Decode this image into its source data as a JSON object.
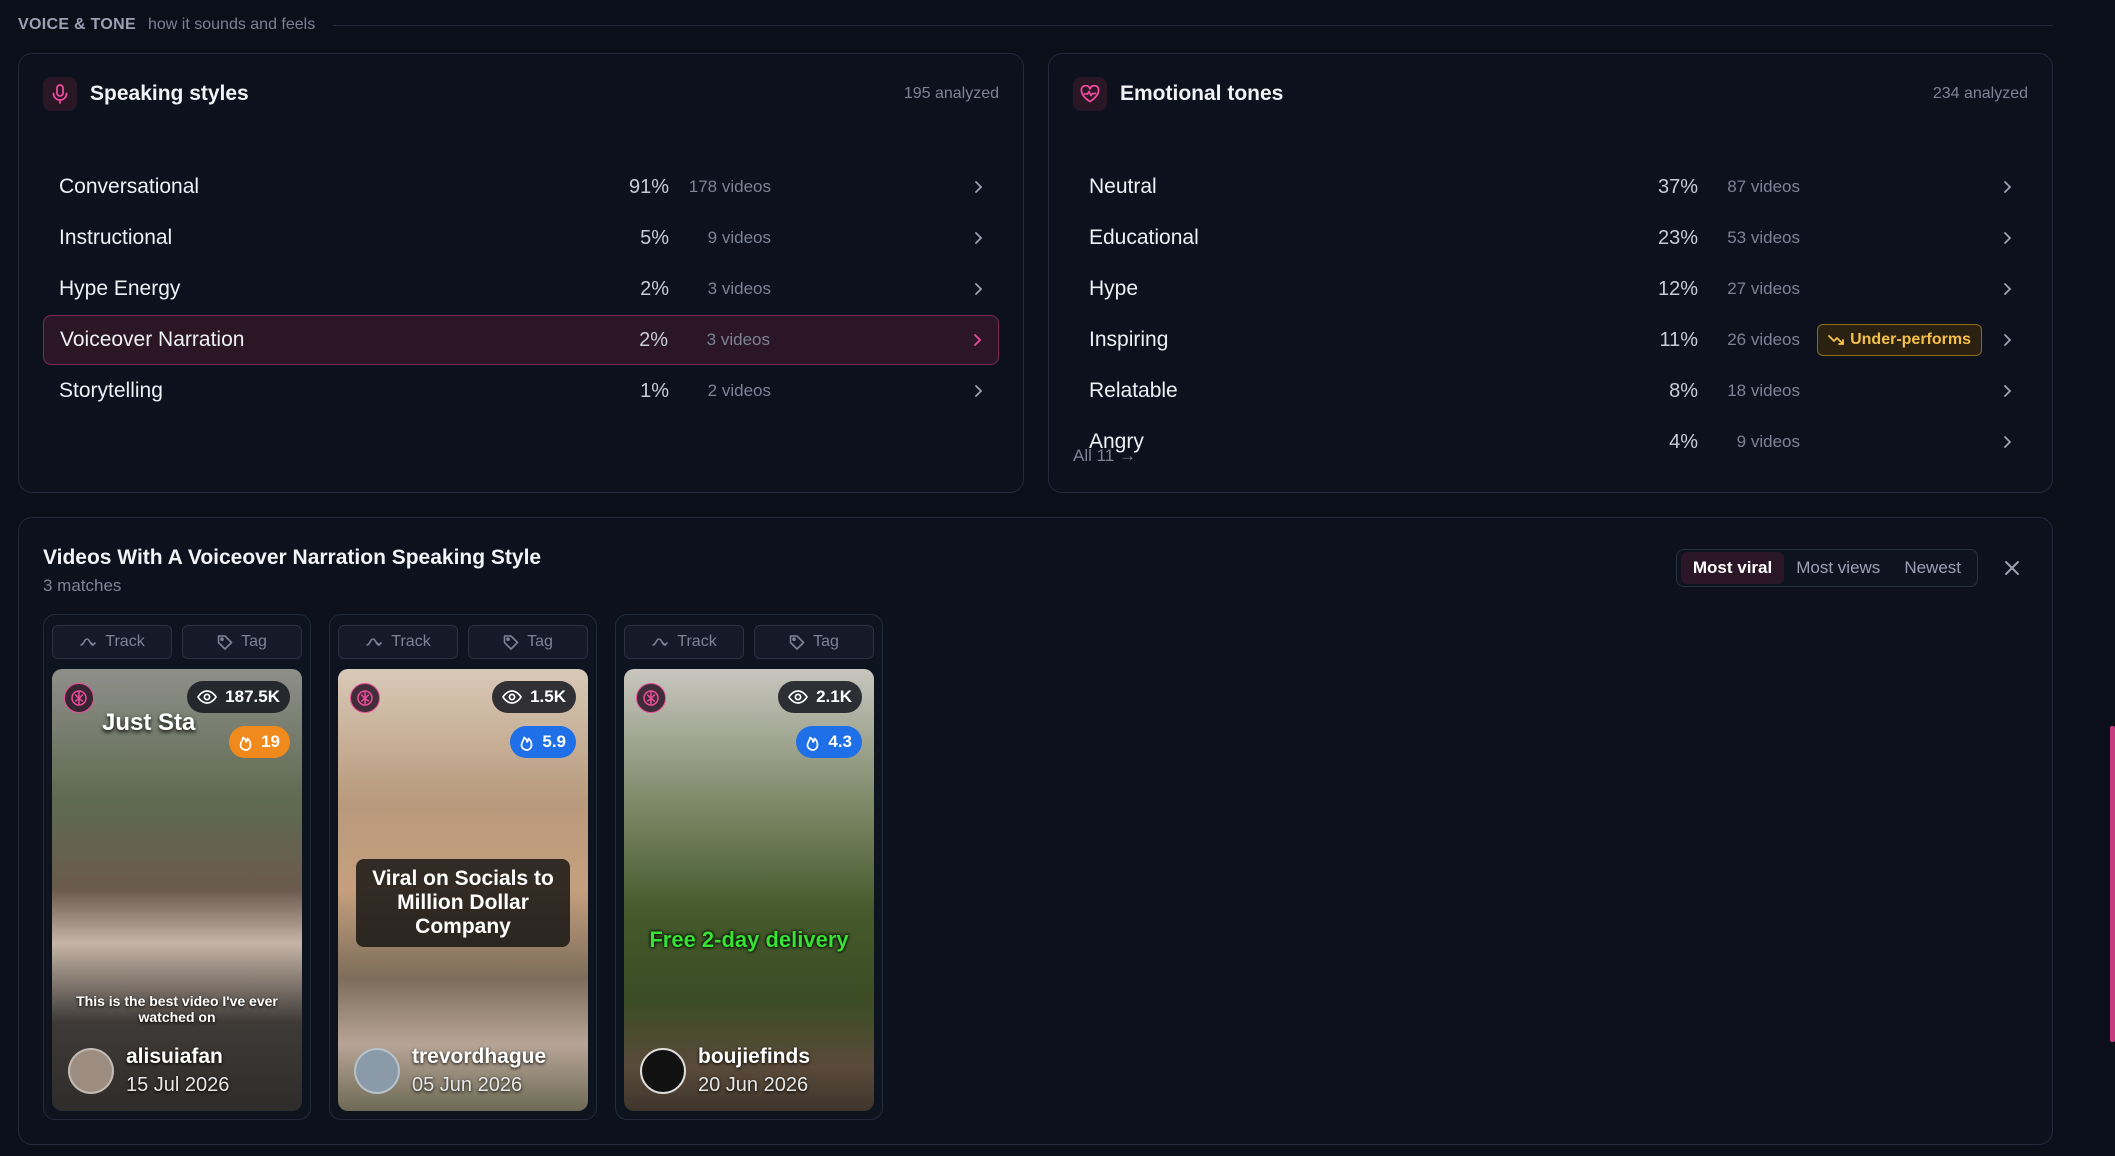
{
  "section": {
    "title": "VOICE & TONE",
    "subtitle": "how it sounds and feels"
  },
  "speaking": {
    "title": "Speaking styles",
    "count": "195 analyzed",
    "items": [
      {
        "label": "Conversational",
        "pct": "91%",
        "videos": "178 videos"
      },
      {
        "label": "Instructional",
        "pct": "5%",
        "videos": "9 videos"
      },
      {
        "label": "Hype Energy",
        "pct": "2%",
        "videos": "3 videos"
      },
      {
        "label": "Voiceover Narration",
        "pct": "2%",
        "videos": "3 videos",
        "active": true
      },
      {
        "label": "Storytelling",
        "pct": "1%",
        "videos": "2 videos"
      }
    ]
  },
  "emotional": {
    "title": "Emotional tones",
    "count": "234 analyzed",
    "items": [
      {
        "label": "Neutral",
        "pct": "37%",
        "videos": "87 videos"
      },
      {
        "label": "Educational",
        "pct": "23%",
        "videos": "53 videos"
      },
      {
        "label": "Hype",
        "pct": "12%",
        "videos": "27 videos"
      },
      {
        "label": "Inspiring",
        "pct": "11%",
        "videos": "26 videos",
        "badge": "Under-performs"
      },
      {
        "label": "Relatable",
        "pct": "8%",
        "videos": "18 videos"
      },
      {
        "label": "Angry",
        "pct": "4%",
        "videos": "9 videos"
      }
    ],
    "all_link": "All 11 →"
  },
  "results": {
    "title": "Videos With A Voiceover Narration Speaking Style",
    "subtitle": "3 matches",
    "sort": [
      "Most viral",
      "Most views",
      "Newest"
    ],
    "actions": {
      "track": "Track",
      "tag": "Tag"
    },
    "cards": [
      {
        "views": "187.5K",
        "score": "19",
        "overlay": "Just Sta",
        "caption": "This is the best video I've ever watched on",
        "user": "alisuiafan",
        "date": "15 Jul 2026"
      },
      {
        "views": "1.5K",
        "score": "5.9",
        "overlay": "Viral on Socials to Million Dollar Company",
        "user": "trevordhague",
        "date": "05 Jun 2026"
      },
      {
        "views": "2.1K",
        "score": "4.3",
        "overlay": "Free 2-day delivery",
        "user": "boujiefinds",
        "date": "20 Jun 2026"
      }
    ]
  },
  "colors": {
    "accent": "#ec4c9b",
    "warning": "#f5c04a",
    "blue": "#1f6fe8",
    "orange": "#f08a1c"
  }
}
